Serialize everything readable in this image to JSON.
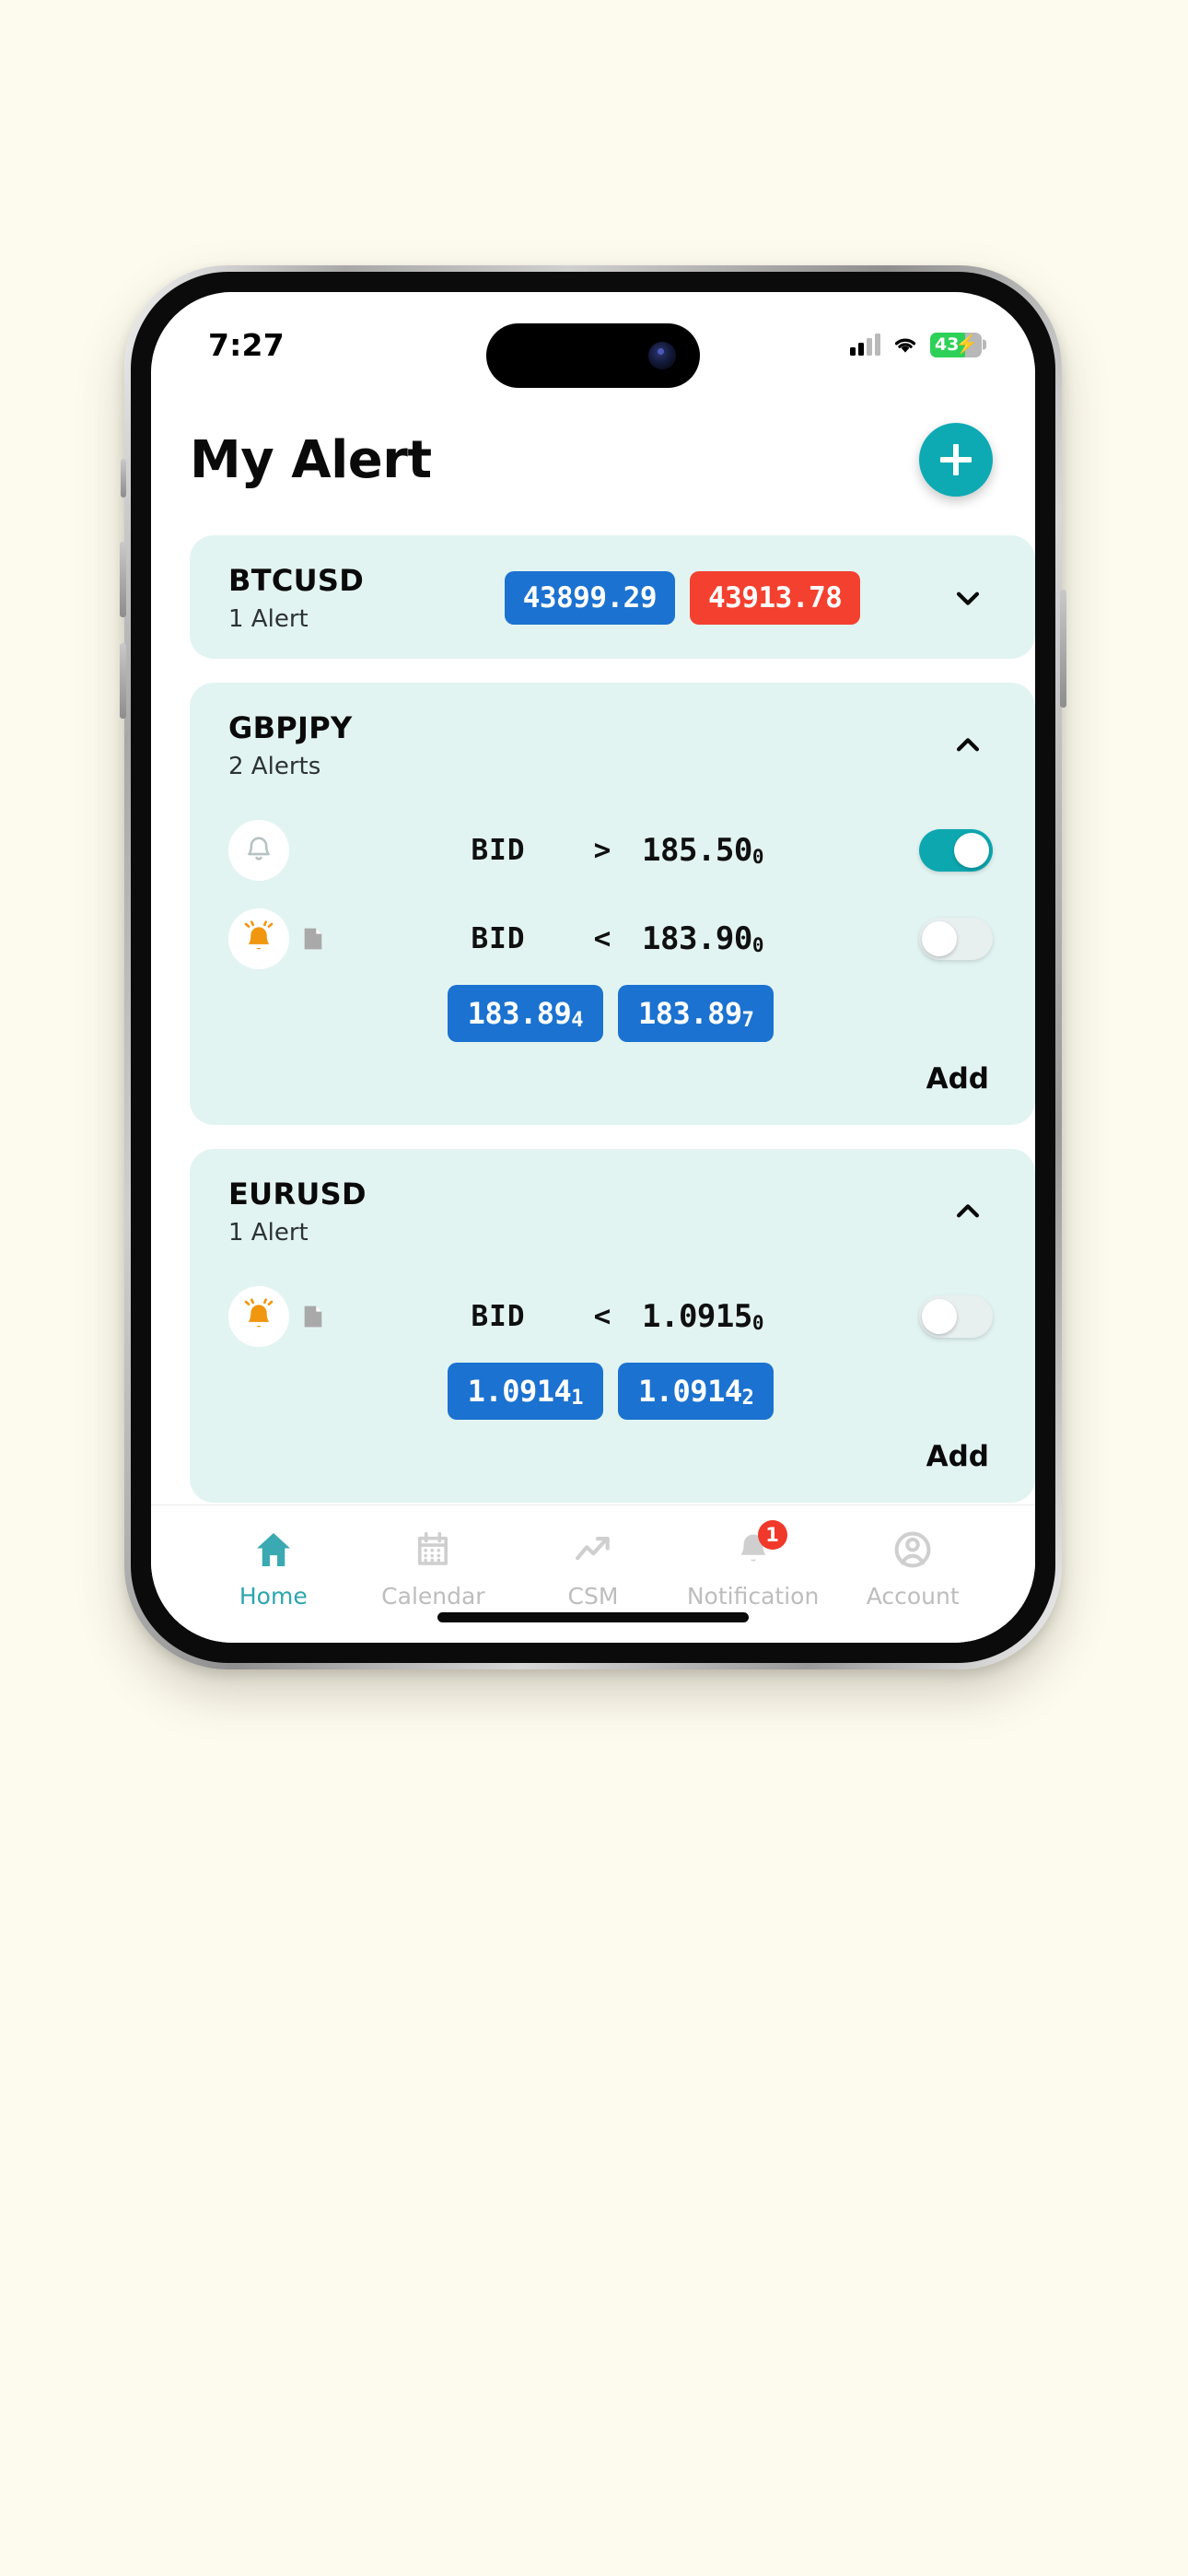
{
  "status_bar": {
    "time": "7:27",
    "battery_percent": "43",
    "battery_charging": true,
    "signal_icon": "cellular-signal-icon",
    "wifi_icon": "wifi-icon",
    "battery_icon": "battery-icon"
  },
  "header": {
    "title": "My Alert",
    "add_button_icon": "plus-icon"
  },
  "accent_colors": {
    "teal": "#0DAAB4",
    "card_bg": "#E2F4F2",
    "bid_blue": "#1B72D0",
    "ask_red": "#F4402F",
    "bell_orange": "#F0960F",
    "badge_red": "#F0392B"
  },
  "cards": [
    {
      "symbol": "BTCUSD",
      "count_label": "1 Alert",
      "expanded": false,
      "chevron_icon": "chevron-down-icon",
      "header_prices": [
        {
          "value": "43899.29",
          "kind": "bid"
        },
        {
          "value": "43913.78",
          "kind": "ask"
        }
      ],
      "rows": []
    },
    {
      "symbol": "GBPJPY",
      "count_label": "2 Alerts",
      "expanded": true,
      "chevron_icon": "chevron-up-icon",
      "header_prices": [],
      "add_label": "Add",
      "rows": [
        {
          "bell_icon": "bell-outline-icon",
          "bell_state": "inactive",
          "has_note": false,
          "note_icon": "note-icon",
          "side": "BID",
          "operator": ">",
          "value": "185.50",
          "value_sub": "0",
          "toggle_on": true,
          "prices": []
        },
        {
          "bell_icon": "bell-ringing-icon",
          "bell_state": "active",
          "has_note": true,
          "note_icon": "note-icon",
          "side": "BID",
          "operator": "<",
          "value": "183.90",
          "value_sub": "0",
          "toggle_on": false,
          "prices": [
            {
              "value": "183.89",
              "sub": "4",
              "kind": "bid"
            },
            {
              "value": "183.89",
              "sub": "7",
              "kind": "bid"
            }
          ]
        }
      ]
    },
    {
      "symbol": "EURUSD",
      "count_label": "1 Alert",
      "expanded": true,
      "chevron_icon": "chevron-up-icon",
      "header_prices": [],
      "add_label": "Add",
      "rows": [
        {
          "bell_icon": "bell-ringing-icon",
          "bell_state": "active",
          "has_note": true,
          "note_icon": "note-icon",
          "side": "BID",
          "operator": "<",
          "value": "1.0915",
          "value_sub": "0",
          "toggle_on": false,
          "prices": [
            {
              "value": "1.0914",
              "sub": "1",
              "kind": "bid"
            },
            {
              "value": "1.0914",
              "sub": "2",
              "kind": "bid"
            }
          ]
        }
      ]
    }
  ],
  "tab_bar": {
    "items": [
      {
        "label": "Home",
        "icon": "home-icon",
        "active": true,
        "badge": null
      },
      {
        "label": "Calendar",
        "icon": "calendar-icon",
        "active": false,
        "badge": null
      },
      {
        "label": "CSM",
        "icon": "trending-up-icon",
        "active": false,
        "badge": null
      },
      {
        "label": "Notification",
        "icon": "bell-icon",
        "active": false,
        "badge": "1"
      },
      {
        "label": "Account",
        "icon": "account-icon",
        "active": false,
        "badge": null
      }
    ]
  }
}
